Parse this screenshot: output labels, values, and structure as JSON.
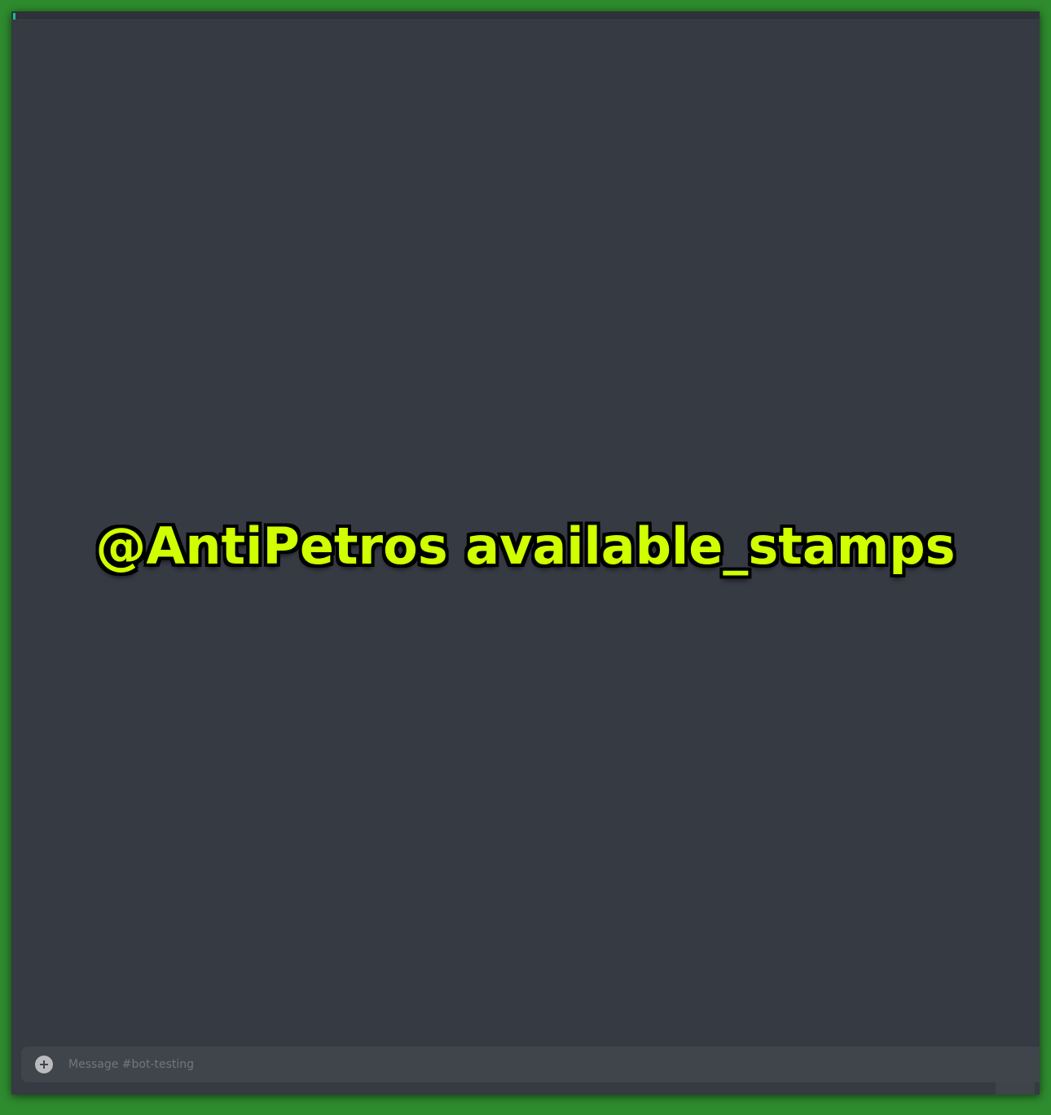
{
  "overlay": {
    "caption": "@AntiPetros available_stamps"
  },
  "composer": {
    "placeholder": "Message #bot-testing",
    "attach_icon": "plus-circle-icon"
  },
  "colors": {
    "page_border": "#2e8b2e",
    "app_background": "#363a43",
    "composer_background": "#40444b",
    "caption_fill": "#cfff00",
    "caption_outline": "#000000",
    "accent": "#1abc9c"
  }
}
